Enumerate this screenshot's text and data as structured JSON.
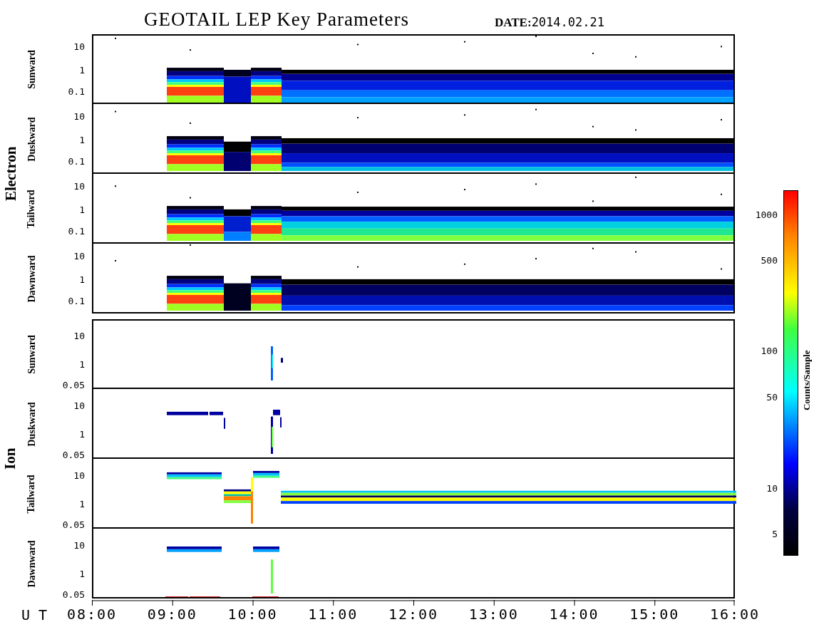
{
  "title": "GEOTAIL LEP Key Parameters",
  "date_label": "DATE:",
  "date": "2014.02.21",
  "groups": [
    {
      "species": "Electron",
      "panels": [
        {
          "direction": "Sunward",
          "yticks": [
            "10",
            "1",
            "0.1"
          ]
        },
        {
          "direction": "Duskward",
          "yticks": [
            "10",
            "1",
            "0.1"
          ]
        },
        {
          "direction": "Tailward",
          "yticks": [
            "10",
            "1",
            "0.1"
          ]
        },
        {
          "direction": "Dawnward",
          "yticks": [
            "10",
            "1",
            "0.1"
          ]
        }
      ]
    },
    {
      "species": "Ion",
      "panels": [
        {
          "direction": "Sunward",
          "yticks": [
            "10",
            "1",
            "0.05"
          ]
        },
        {
          "direction": "Duskward",
          "yticks": [
            "10",
            "1",
            "0.05"
          ]
        },
        {
          "direction": "Tailward",
          "yticks": [
            "10",
            "1",
            "0.05"
          ]
        },
        {
          "direction": "Dawnward",
          "yticks": [
            "10",
            "1",
            "0.05"
          ]
        }
      ]
    }
  ],
  "colorbar": {
    "label": "Counts/Sample",
    "ticks": [
      "1000",
      "500",
      "100",
      "50",
      "10",
      "5"
    ]
  },
  "time_axis": {
    "label": "U T",
    "ticks": [
      "08:00",
      "09:00",
      "10:00",
      "11:00",
      "12:00",
      "13:00",
      "14:00",
      "15:00",
      "16:00"
    ]
  }
}
